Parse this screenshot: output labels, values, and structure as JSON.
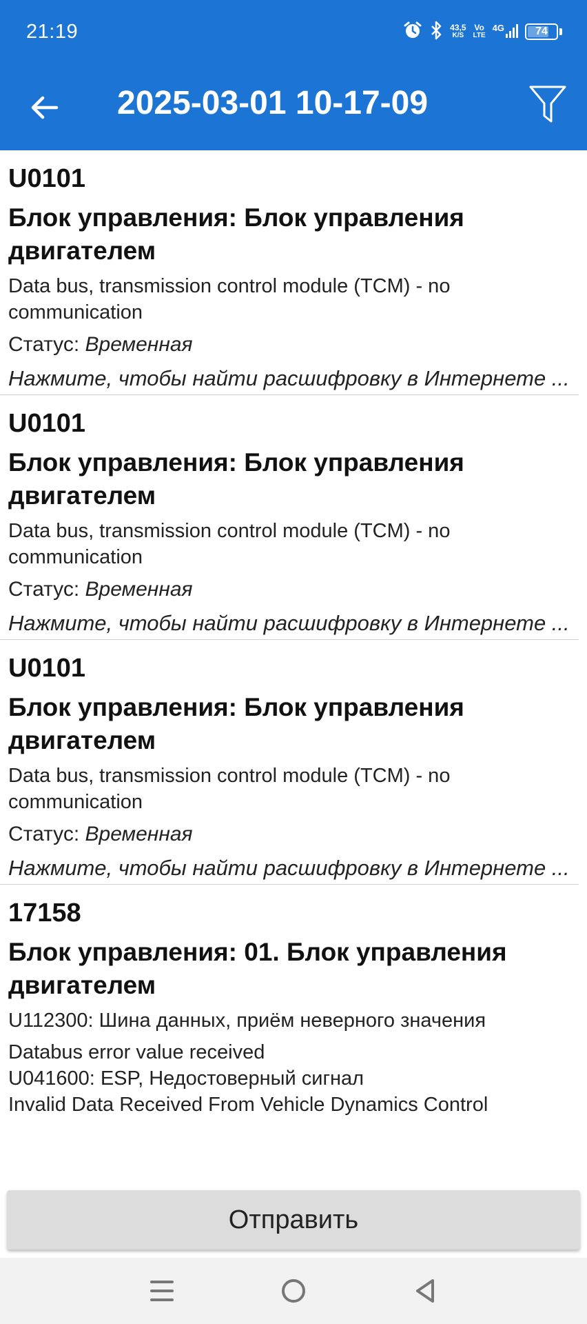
{
  "status_bar": {
    "time": "21:19",
    "net_speed_value": "43,5",
    "net_speed_unit": "K/S",
    "volte_top": "Vo",
    "volte_bottom": "LTE",
    "network": "4G",
    "battery": "74",
    "battery_level": 0.74,
    "icons": [
      "alarm-icon",
      "bluetooth-icon",
      "signal-icon",
      "battery-icon"
    ]
  },
  "app_bar": {
    "title": "2025-03-01 10-17-09",
    "back_icon": "arrow-left-icon",
    "filter_icon": "filter-icon",
    "background": "#1c74d4"
  },
  "items": [
    {
      "code": "U0101",
      "module": "Блок управления: Блок управления двигателем",
      "description": "Data bus, transmission control module (TCM) - no communication",
      "status_label": "Статус: ",
      "status_value": "Временная",
      "search_hint": "Нажмите, чтобы найти расшифровку в Интернете ..."
    },
    {
      "code": "U0101",
      "module": "Блок управления: Блок управления двигателем",
      "description": "Data bus, transmission control module (TCM) - no communication",
      "status_label": "Статус: ",
      "status_value": "Временная",
      "search_hint": "Нажмите, чтобы найти расшифровку в Интернете ..."
    },
    {
      "code": "U0101",
      "module": "Блок управления: Блок управления двигателем",
      "description": "Data bus, transmission control module (TCM) - no communication",
      "status_label": "Статус: ",
      "status_value": "Временная",
      "search_hint": "Нажмите, чтобы найти расшифровку в Интернете ..."
    },
    {
      "code": "17158",
      "module": "Блок управления: 01. Блок управления двигателем",
      "details": [
        "U112300: Шина данных, приём неверного значения",
        "Databus error value received",
        "U041600: ESP, Недостоверный сигнал",
        "Invalid Data Received From Vehicle Dynamics Control"
      ]
    }
  ],
  "send_button": {
    "label": "Отправить"
  },
  "nav_bar": {
    "icons": [
      "menu-icon",
      "home-icon",
      "back-triangle-icon"
    ]
  }
}
